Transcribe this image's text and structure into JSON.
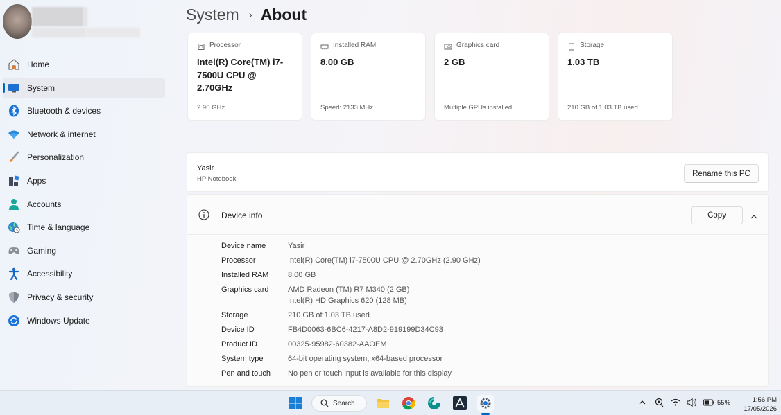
{
  "breadcrumb": {
    "parent": "System",
    "separator": "›",
    "current": "About"
  },
  "sidebar": {
    "items": [
      {
        "label": "Home",
        "icon": "home-icon"
      },
      {
        "label": "System",
        "icon": "monitor-icon",
        "active": true
      },
      {
        "label": "Bluetooth & devices",
        "icon": "bluetooth-icon"
      },
      {
        "label": "Network & internet",
        "icon": "wifi-icon"
      },
      {
        "label": "Personalization",
        "icon": "brush-icon"
      },
      {
        "label": "Apps",
        "icon": "apps-icon"
      },
      {
        "label": "Accounts",
        "icon": "person-icon"
      },
      {
        "label": "Time & language",
        "icon": "globe-clock-icon"
      },
      {
        "label": "Gaming",
        "icon": "gamepad-icon"
      },
      {
        "label": "Accessibility",
        "icon": "accessibility-icon"
      },
      {
        "label": "Privacy & security",
        "icon": "shield-icon"
      },
      {
        "label": "Windows Update",
        "icon": "update-icon"
      }
    ]
  },
  "cards": [
    {
      "title": "Processor",
      "value": "Intel(R) Core(TM) i7-7500U CPU @ 2.70GHz",
      "sub": "2.90 GHz",
      "icon": "processor-icon"
    },
    {
      "title": "Installed RAM",
      "value": "8.00 GB",
      "sub": "Speed: 2133 MHz",
      "icon": "ram-icon"
    },
    {
      "title": "Graphics card",
      "value": "2 GB",
      "sub": "Multiple GPUs installed",
      "icon": "graphics-card-icon"
    },
    {
      "title": "Storage",
      "value": "1.03 TB",
      "sub": "210 GB of 1.03 TB used",
      "icon": "storage-icon"
    }
  ],
  "pc": {
    "name": "Yasir",
    "model": "HP Notebook",
    "rename_label": "Rename this PC"
  },
  "device_info": {
    "title": "Device info",
    "copy_label": "Copy",
    "rows": [
      {
        "label": "Device name",
        "value": "Yasir"
      },
      {
        "label": "Processor",
        "value": "Intel(R) Core(TM) i7-7500U CPU @ 2.70GHz (2.90 GHz)"
      },
      {
        "label": "Installed RAM",
        "value": "8.00 GB"
      },
      {
        "label": "Graphics card",
        "value": "AMD Radeon (TM) R7 M340 (2 GB)",
        "value2": "Intel(R) HD Graphics 620 (128 MB)"
      },
      {
        "label": "Storage",
        "value": "210 GB of 1.03 TB used"
      },
      {
        "label": "Device ID",
        "value": "FB4D0063-6BC6-4217-A8D2-919199D34C93"
      },
      {
        "label": "Product ID",
        "value": "00325-95982-60382-AAOEM"
      },
      {
        "label": "System type",
        "value": "64-bit operating system, x64-based processor"
      },
      {
        "label": "Pen and touch",
        "value": "No pen or touch input is available for this display"
      }
    ]
  },
  "taskbar": {
    "search_label": "Search",
    "apps": [
      "windows-start-icon",
      "file-explorer-icon",
      "chrome-icon",
      "edge-dev-icon",
      "autocad-icon",
      "settings-icon"
    ],
    "battery_percent": "55%",
    "time": "1:56 PM",
    "date": "17/05/2026"
  },
  "colors": {
    "accent": "#0067c0"
  }
}
